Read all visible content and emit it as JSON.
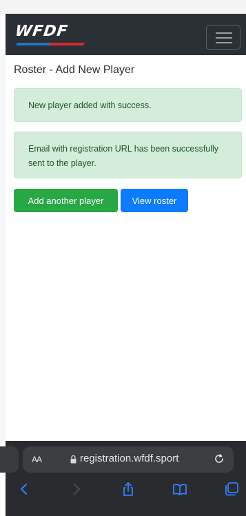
{
  "navbar": {
    "logo_text": "WFDF",
    "menu_icon": "hamburger-icon"
  },
  "page": {
    "title": "Roster - Add New Player"
  },
  "alerts": [
    {
      "text": "New player added with success."
    },
    {
      "text": "Email with registration URL has been successfully sent to the player."
    }
  ],
  "buttons": {
    "add_another": "Add another player",
    "view_roster": "View roster"
  },
  "browser": {
    "aa_label": "AA",
    "url": "registration.wfdf.sport",
    "toolbar_icons": [
      "back-icon",
      "forward-icon",
      "share-icon",
      "bookmarks-icon",
      "tabs-icon"
    ]
  },
  "colors": {
    "navbar_bg": "#2b3036",
    "alert_bg": "#d4edda",
    "alert_text": "#155724",
    "btn_success": "#28a745",
    "btn_primary": "#0d7bff",
    "safari_bar": "#2a2b2e",
    "toolbar_icon": "#2f7fff"
  }
}
